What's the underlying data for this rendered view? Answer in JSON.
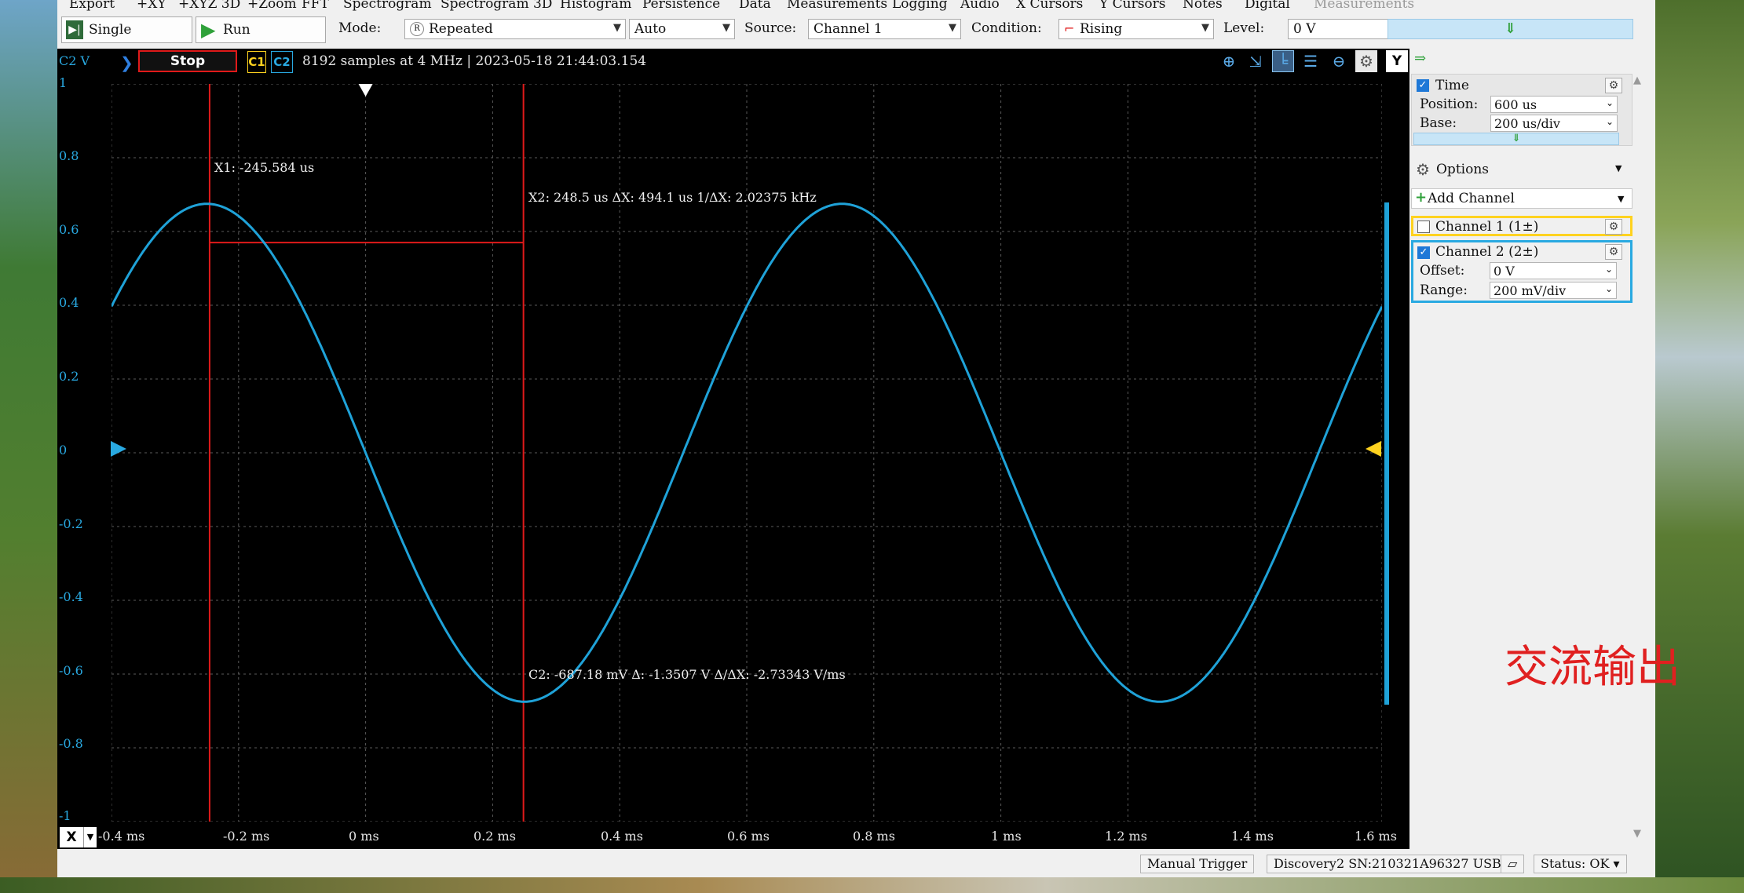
{
  "menu": [
    "Export",
    "+XY",
    "+XYZ 3D",
    "+Zoom",
    "FFT",
    "Spectrogram",
    "Spectrogram 3D",
    "Histogram",
    "Persistence",
    "Data",
    "Measurements",
    "Logging",
    "Audio",
    "X Cursors",
    "Y Cursors",
    "Notes",
    "Digital",
    "Measurements"
  ],
  "toolbar": {
    "single_label": "Single",
    "run_label": "Run",
    "mode_label": "Mode:",
    "mode_value": "Repeated",
    "trigger_value": "Auto",
    "source_label": "Source:",
    "source_value": "Channel 1",
    "condition_label": "Condition:",
    "condition_value": "Rising",
    "level_label": "Level:",
    "level_value": "0 V"
  },
  "infobar": {
    "c2v": "C2 V",
    "stop": "Stop",
    "c1": "C1",
    "c2": "C2",
    "acquisition": "8192 samples at 4 MHz | 2023-05-18 21:44:03.154",
    "y_button": "Y"
  },
  "plot": {
    "y_ticks": [
      "1",
      "0.8",
      "0.6",
      "0.4",
      "0.2",
      "0",
      "-0.2",
      "-0.4",
      "-0.6",
      "-0.8",
      "-1"
    ],
    "x_ticks": [
      "-0.4 ms",
      "-0.2 ms",
      "0 ms",
      "0.2 ms",
      "0.4 ms",
      "0.6 ms",
      "0.8 ms",
      "1 ms",
      "1.2 ms",
      "1.4 ms",
      "1.6 ms"
    ],
    "x_button": "X",
    "cursor_x1": "X1: -245.584 us",
    "cursor_x2": "X2: 248.5 us    ΔX: 494.1 us   1/ΔX: 2.02375 kHz",
    "cursor_c2": "C2: -687.18 mV  Δ: -1.3507 V   Δ/ΔX: -2.73343 V/ms"
  },
  "chart_data": {
    "type": "line",
    "xlabel": "",
    "ylabel": "",
    "xlim": [
      -0.4,
      1.6
    ],
    "ylim": [
      -1,
      1
    ],
    "x_unit": "ms",
    "y_unit": "V",
    "series": [
      {
        "amplitude": 0.675,
        "frequency_khz": 1.0,
        "phase_zero_ms": 0.0,
        "color": "#1fa2d8"
      }
    ],
    "cursors": {
      "x1_ms": -0.245584,
      "x2_ms": 0.2485,
      "x1_value_v": 0.57,
      "x2_value_v": -0.68718
    },
    "trigger_x_ms": 0.0,
    "trigger_level_v": 0
  },
  "panel": {
    "time_label": "Time",
    "position_label": "Position:",
    "position_value": "600 us",
    "base_label": "Base:",
    "base_value": "200 us/div",
    "options_label": "Options",
    "add_channel_label": "Add Channel",
    "channel1_label": "Channel 1 (1±)",
    "channel2_label": "Channel 2 (2±)",
    "offset_label": "Offset:",
    "offset_value": "0 V",
    "range_label": "Range:",
    "range_value": "200 mV/div"
  },
  "status": {
    "trigger": "Manual Trigger",
    "device": "Discovery2 SN:210321A96327 USB",
    "state": "Status: OK"
  },
  "annotation": "交流输出",
  "colors": {
    "channel1": "#ffd21f",
    "channel2": "#29a9e1",
    "cursor": "#e01a1a"
  }
}
